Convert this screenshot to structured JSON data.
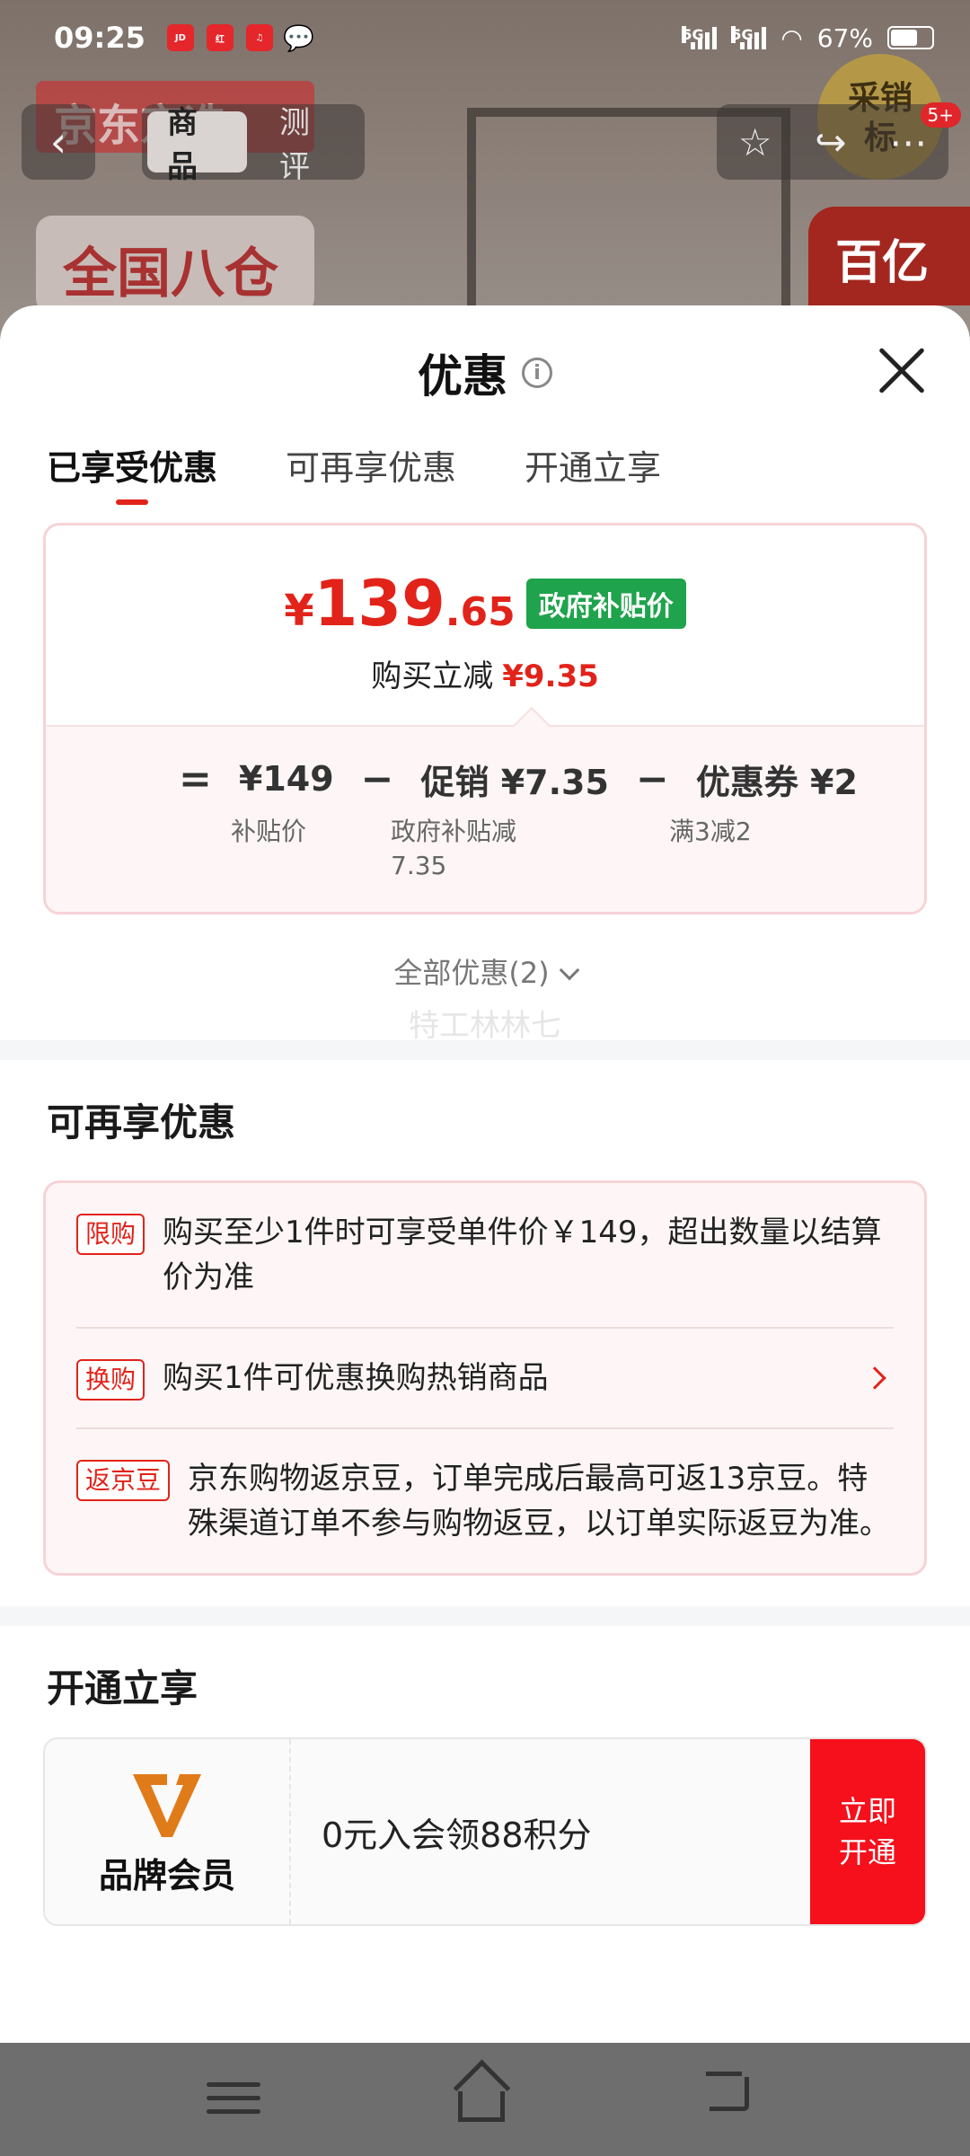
{
  "status_bar": {
    "time": "09:25",
    "network_1": "5G",
    "network_2": "5G",
    "battery": "67%",
    "battery_level": 0.67,
    "app_icons": [
      "jd-app-icon",
      "xiaohongshu-icon",
      "netease-music-icon",
      "wechat-icon"
    ]
  },
  "background": {
    "banner_text": "京东京造",
    "sticker_text": "全国八仓",
    "badge_text": "采销\n标",
    "red_tag_text": "百亿"
  },
  "top_nav": {
    "tabs": [
      "商品",
      "测评"
    ],
    "badge": "5+"
  },
  "sheet": {
    "title": "优惠",
    "tabs": [
      "已享受优惠",
      "可再享优惠",
      "开通立享"
    ],
    "price": {
      "yen": "¥",
      "integer": "139",
      "decimal": ".65",
      "tag": "政府补贴价",
      "reduce_label": "购买立减",
      "reduce_value": "¥9.35"
    },
    "calc": {
      "eq": "=",
      "minus": "−",
      "base": "¥149",
      "promo": "促销 ¥7.35",
      "coupon": "优惠券 ¥2",
      "base_label": "补贴价",
      "promo_label_1": "政府补贴减",
      "promo_label_2": "7.35",
      "coupon_label": "满3减2"
    },
    "all_offers": "全部优惠(2)",
    "watermark": "特工林林七",
    "more_title": "可再享优惠",
    "offers": [
      {
        "tag": "限购",
        "text": "购买至少1件时可享受单件价￥149，超出数量以结算价为准"
      },
      {
        "tag": "换购",
        "text": "购买1件可优惠换购热销商品"
      },
      {
        "tag": "返京豆",
        "text": "京东购物返京豆，订单完成后最高可返13京豆。特殊渠道订单不参与购物返豆，以订单实际返豆为准。"
      }
    ],
    "open_title": "开通立享",
    "member": {
      "label": "品牌会员",
      "text": "0元入会领88积分",
      "button": "立即开通"
    }
  },
  "colors": {
    "accent_red": "#e2231a",
    "gov_green": "#1fa34c",
    "button_red": "#f5101c"
  }
}
